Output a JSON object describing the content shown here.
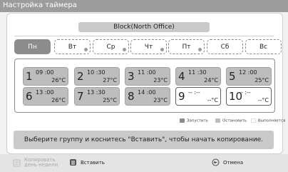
{
  "title": "Настройка таймера",
  "block_name": "Block(North Office)",
  "days": [
    {
      "label": "Пн",
      "active": true,
      "dot": false
    },
    {
      "label": "Вт",
      "active": false,
      "dot": true
    },
    {
      "label": "Ср",
      "active": false,
      "dot": true
    },
    {
      "label": "Чт",
      "active": false,
      "dot": true
    },
    {
      "label": "Пт",
      "active": false,
      "dot": true
    },
    {
      "label": "Сб",
      "active": false,
      "dot": false
    },
    {
      "label": "Вс",
      "active": false,
      "dot": false
    }
  ],
  "timers": [
    {
      "num": "1",
      "time": "09 :00",
      "temp": "26°C",
      "set": true
    },
    {
      "num": "2",
      "time": "10 :30",
      "temp": "27°C",
      "set": true
    },
    {
      "num": "3",
      "time": "11 :00",
      "temp": "23°C",
      "set": true
    },
    {
      "num": "4",
      "time": "11 :30",
      "temp": "24°C",
      "set": true
    },
    {
      "num": "5",
      "time": "12 :00",
      "temp": "25°C",
      "set": true
    },
    {
      "num": "6",
      "time": "13 :00",
      "temp": "26°C",
      "set": true
    },
    {
      "num": "7",
      "time": "13 :30",
      "temp": "25°C",
      "set": true
    },
    {
      "num": "8",
      "time": "14 :00",
      "temp": "23°C",
      "set": true
    },
    {
      "num": "9",
      "time": "-- :--",
      "temp": "--°C",
      "set": false
    },
    {
      "num": "10",
      "time": "-- :--",
      "temp": "--°C",
      "set": false
    }
  ],
  "legend": {
    "start": "Запустить",
    "stop": "Остановить",
    "done": "Выполняется"
  },
  "message": "Выберите группу и коснитесь \"Вставить\", чтобы начать копирование.",
  "buttons": {
    "copy_day": "Копировать день недели",
    "paste": "Вставить",
    "cancel": "Отмена"
  },
  "colors": {
    "titlebar": "#9c9c9c",
    "active_day": "#8c8c8c",
    "tile": "#bdbdbd"
  }
}
